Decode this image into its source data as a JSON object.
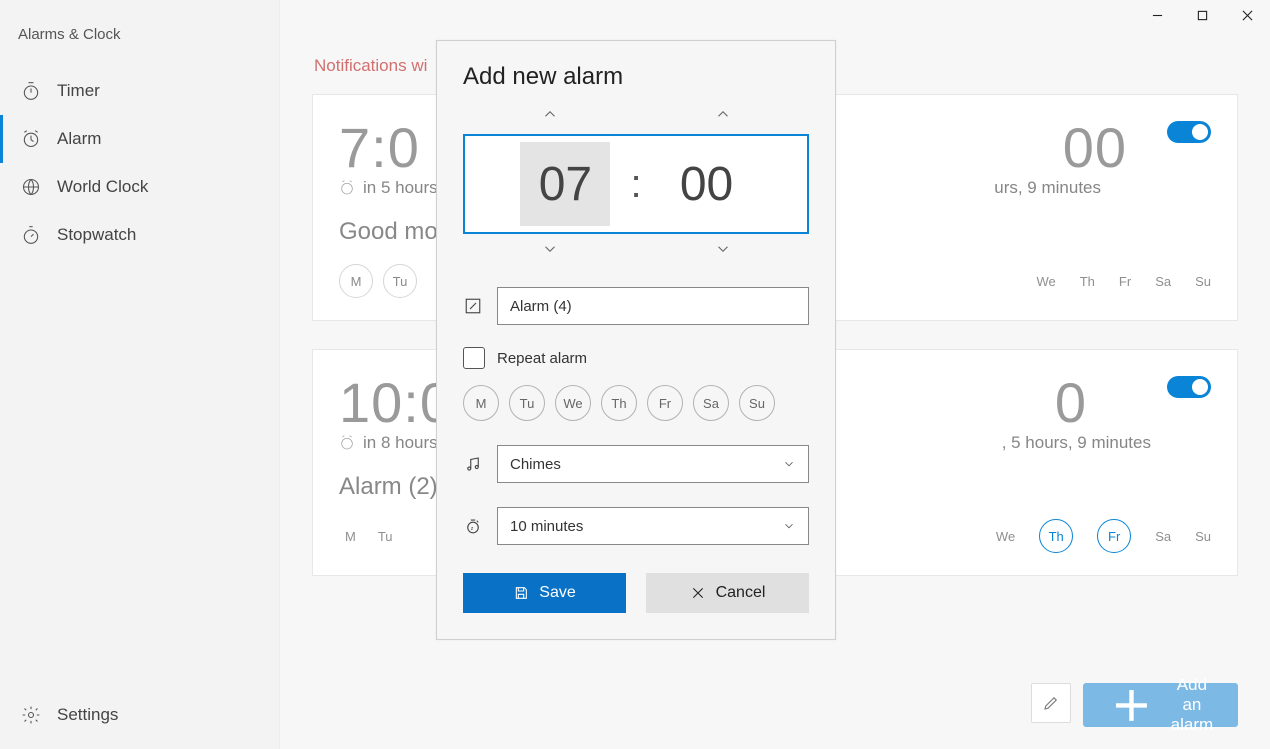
{
  "app_title": "Alarms & Clock",
  "window_controls": {
    "minimize": "–",
    "maximize": "□",
    "close": "✕"
  },
  "sidebar": {
    "items": [
      {
        "label": "Timer"
      },
      {
        "label": "Alarm"
      },
      {
        "label": "World Clock"
      },
      {
        "label": "Stopwatch"
      }
    ],
    "settings": {
      "label": "Settings"
    }
  },
  "notification_banner": "Notifications wi",
  "alarms": [
    {
      "time": "7:0",
      "sub": "in 5 hours",
      "name": "Good mo",
      "toggle": true,
      "right_time": "00",
      "right_sub": "urs, 9 minutes",
      "days": [
        "M",
        "Tu"
      ],
      "days_right": [
        "We",
        "Th",
        "Fr",
        "Sa",
        "Su"
      ],
      "days_right_sel": []
    },
    {
      "time": "10:0",
      "sub": "in 8 hours",
      "name": "Alarm (2)",
      "toggle": true,
      "right_time": "0",
      "right_sub": ", 5 hours, 9 minutes",
      "days": [
        "M",
        "Tu"
      ],
      "days_right": [
        "We",
        "Th",
        "Fr",
        "Sa",
        "Su"
      ],
      "days_right_sel": [
        "Th",
        "Fr"
      ]
    }
  ],
  "bottom": {
    "add_label": "Add an alarm"
  },
  "dialog": {
    "title": "Add new alarm",
    "hour": "07",
    "minute": "00",
    "name_value": "Alarm (4)",
    "repeat_label": "Repeat alarm",
    "days": [
      "M",
      "Tu",
      "We",
      "Th",
      "Fr",
      "Sa",
      "Su"
    ],
    "sound": "Chimes",
    "snooze": "10 minutes",
    "save_label": "Save",
    "cancel_label": "Cancel"
  }
}
